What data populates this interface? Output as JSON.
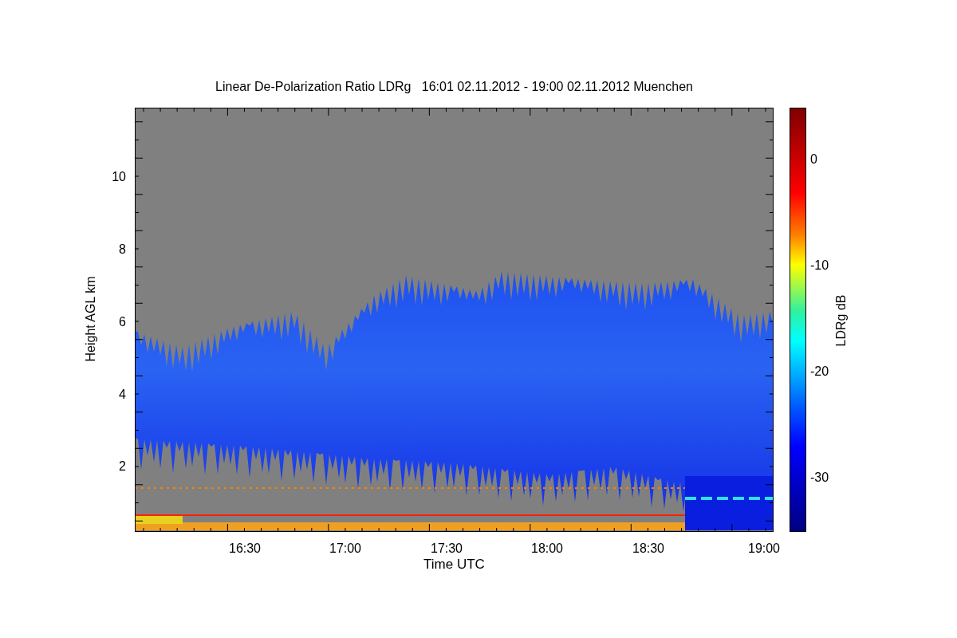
{
  "title": "Linear De-Polarization Ratio LDRg   16:01 02.11.2012 - 19:00 02.11.2012 Muenchen",
  "y_axis": {
    "label": "Height AGL km",
    "ticks": [
      "10",
      "8",
      "6",
      "4",
      "2"
    ]
  },
  "x_axis": {
    "label": "Time UTC",
    "ticks": [
      "16:30",
      "17:00",
      "17:30",
      "18:00",
      "18:30",
      "19:00"
    ]
  },
  "colorbar": {
    "label": "LDRg dB",
    "ticks": [
      "0",
      "-10",
      "-20",
      "-30"
    ]
  }
}
